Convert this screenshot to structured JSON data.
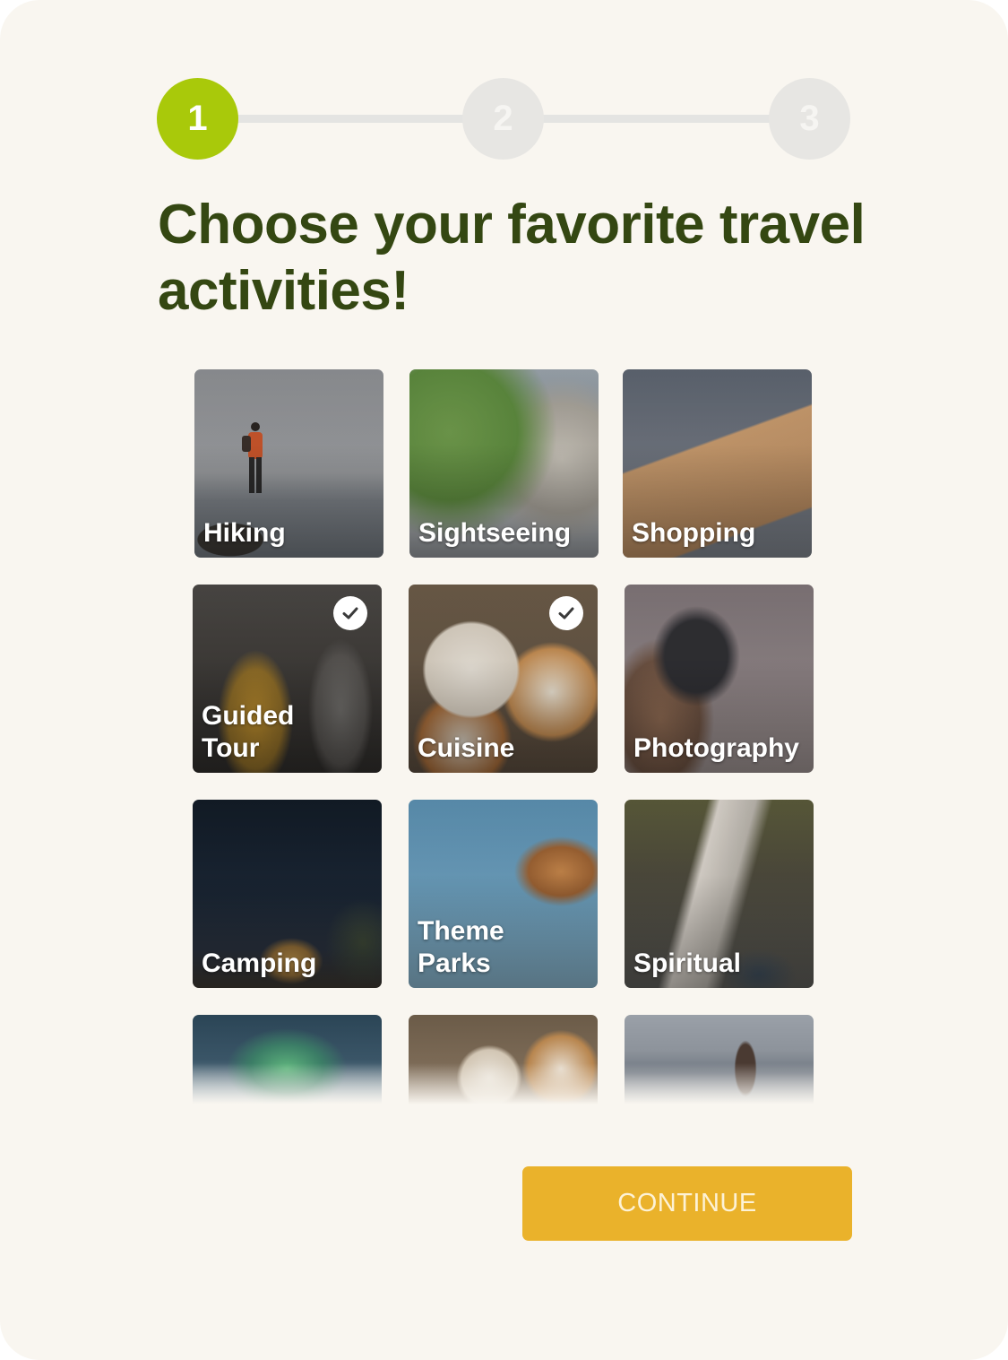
{
  "stepper": {
    "steps": [
      "1",
      "2",
      "3"
    ],
    "active_step": 1,
    "active_color": "#a9c90a",
    "inactive_color": "#e7e6e3"
  },
  "title": "Choose your favorite travel activities!",
  "activities": [
    {
      "label": "Hiking",
      "selected": false,
      "icon": "hiker-photo"
    },
    {
      "label": "Sightseeing",
      "selected": false,
      "icon": "tourist-photo"
    },
    {
      "label": "Shopping",
      "selected": false,
      "icon": "shopping-bag-photo"
    },
    {
      "label": "Guided\nTour",
      "selected": true,
      "icon": "tour-group-photo"
    },
    {
      "label": "Cuisine",
      "selected": true,
      "icon": "food-table-photo"
    },
    {
      "label": "Photography",
      "selected": false,
      "icon": "camera-photo"
    },
    {
      "label": "Camping",
      "selected": false,
      "icon": "tent-night-photo"
    },
    {
      "label": "Theme\nParks",
      "selected": false,
      "icon": "carousel-photo"
    },
    {
      "label": "Spiritual",
      "selected": false,
      "icon": "waterfall-photo"
    }
  ],
  "partial_activities": [
    {
      "icon": "aurora-photo"
    },
    {
      "icon": "food-table-photo"
    },
    {
      "icon": "mountain-hiker-photo"
    }
  ],
  "check_icon": "checkmark-icon",
  "continue_label": "CONTINUE",
  "colors": {
    "background": "#f9f6f0",
    "title": "#344712",
    "button": "#eab22b",
    "button_text": "#fdf2d6"
  }
}
